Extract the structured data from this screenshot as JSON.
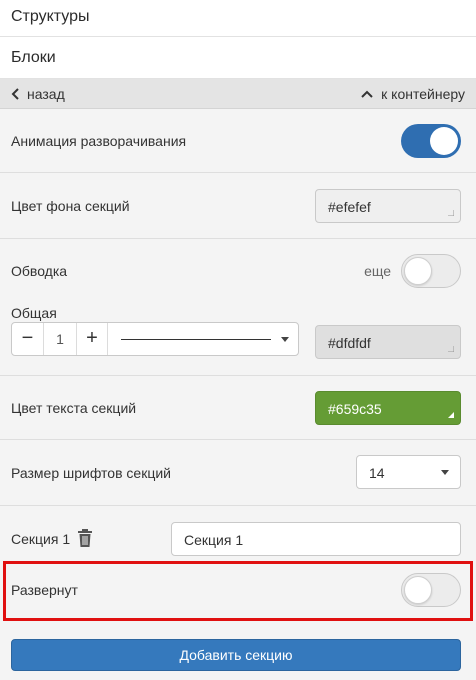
{
  "nav": {
    "structures_label": "Структуры",
    "blocks_label": "Блоки"
  },
  "backbar": {
    "back_label": "назад",
    "container_label": "к контейнеру"
  },
  "expand_animation": {
    "label": "Анимация разворачивания",
    "enabled": true
  },
  "section_bg_color": {
    "label": "Цвет фона секций",
    "value": "#efefef"
  },
  "border": {
    "label": "Обводка",
    "more_label": "еще",
    "enabled": false,
    "general_label": "Общая",
    "width_value": "1",
    "minus_label": "−",
    "plus_label": "+",
    "color_value": "#dfdfdf"
  },
  "section_text_color": {
    "label": "Цвет текста секций",
    "value": "#659c35"
  },
  "section_font_size": {
    "label": "Размер шрифтов секций",
    "value": "14"
  },
  "section1": {
    "label": "Секция 1",
    "name_value": "Секция 1"
  },
  "expanded": {
    "label": "Развернут",
    "enabled": false
  },
  "add_section_label": "Добавить секцию",
  "colors": {
    "accent": "#2f6eb1",
    "button": "#3579bd",
    "text_color_swatch": "#659c35",
    "highlight": "#e01010"
  }
}
